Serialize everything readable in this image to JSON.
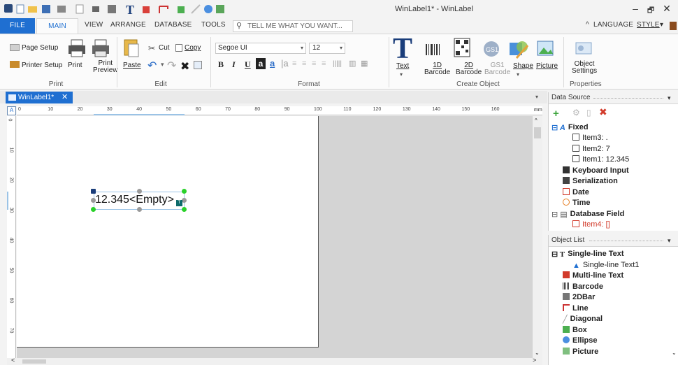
{
  "window": {
    "title": "WinLabel1* - WinLabel",
    "minimize": "–",
    "restore": "🗗",
    "close": "✕"
  },
  "tabs": {
    "file": "FILE",
    "main": "MAIN",
    "view": "VIEW",
    "arrange": "ARRANGE",
    "database": "DATABASE",
    "tools": "TOOLS",
    "tell_me": "TELL ME WHAT YOU WANT...",
    "language": "LANGUAGE",
    "style": "STYLE"
  },
  "ribbon": {
    "print_group": {
      "label": "Print",
      "page_setup": "Page Setup",
      "printer_setup": "Printer Setup",
      "print": "Print",
      "print_preview": [
        "Print",
        "Preview"
      ]
    },
    "edit_group": {
      "label": "Edit",
      "paste": "Paste",
      "cut": "Cut",
      "copy": "Copy"
    },
    "format_group": {
      "label": "Format",
      "font": "Segoe UI",
      "size": "12",
      "bold": "B",
      "italic": "I",
      "underline": "U"
    },
    "create_group": {
      "label": "Create Object",
      "text": "Text",
      "barcode1d": [
        "1D",
        "Barcode"
      ],
      "barcode2d": [
        "2D",
        "Barcode"
      ],
      "gs1": [
        "GS1",
        "Barcode"
      ],
      "shape": "Shape",
      "picture": "Picture"
    },
    "properties_group": {
      "label": "Properties",
      "object_settings": [
        "Object",
        "Settings"
      ]
    }
  },
  "document": {
    "tab": "WinLabel1*",
    "ruler_unit": "mm",
    "hruler_marks": [
      "0",
      "10",
      "20",
      "30",
      "40",
      "50",
      "60",
      "70",
      "80",
      "90",
      "100",
      "110",
      "120",
      "130",
      "140",
      "150",
      "160"
    ],
    "vruler_marks": [
      "0",
      "10",
      "20",
      "30",
      "40",
      "50",
      "60",
      "70"
    ],
    "object_text": "12.345<Empty>"
  },
  "data_source": {
    "title": "Data Source",
    "fixed": "Fixed",
    "item3": "Item3: .",
    "item2": "Item2: 7",
    "item1": "Item1: 12.345",
    "keyboard": "Keyboard Input",
    "serialization": "Serialization",
    "date": "Date",
    "time": "Time",
    "db_field": "Database Field",
    "item4": "Item4: []"
  },
  "object_list": {
    "title": "Object List",
    "single_line": "Single-line Text",
    "single_line_1": "Single-line Text1",
    "multi_line": "Multi-line Text",
    "barcode": "Barcode",
    "twodbar": "2DBar",
    "line": "Line",
    "diagonal": "Diagonal",
    "box": "Box",
    "ellipse": "Ellipse",
    "picture": "Picture"
  },
  "colors": {
    "accent": "#1f6fd1",
    "handle_green": "#2ad12a",
    "handle_gray": "#9a9a9a",
    "red": "#d23b2b"
  }
}
